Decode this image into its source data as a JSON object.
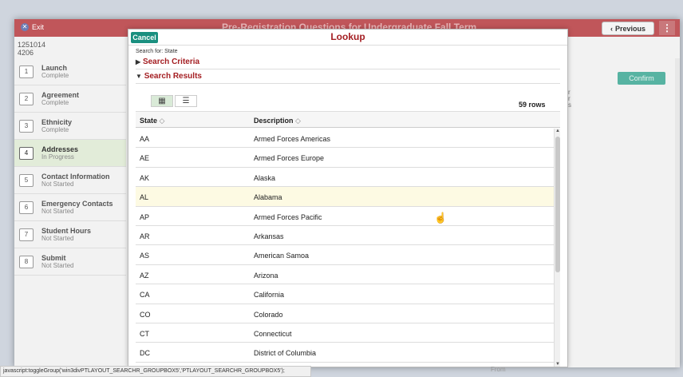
{
  "header": {
    "exit_label": "Exit",
    "exit_icon": "close-circle-icon",
    "title": "Pre-Registration Questions for Undergraduate Fall Term",
    "previous_label": "Previous",
    "menu_icon": "more-vertical-icon"
  },
  "ids": [
    "1251014",
    "4206"
  ],
  "nav": {
    "items": [
      {
        "number": "1",
        "title": "Launch",
        "status": "Complete"
      },
      {
        "number": "2",
        "title": "Agreement",
        "status": "Complete"
      },
      {
        "number": "3",
        "title": "Ethnicity",
        "status": "Complete"
      },
      {
        "number": "4",
        "title": "Addresses",
        "status": "In Progress"
      },
      {
        "number": "5",
        "title": "Contact Information",
        "status": "Not Started"
      },
      {
        "number": "6",
        "title": "Emergency Contacts",
        "status": "Not Started"
      },
      {
        "number": "7",
        "title": "Student Hours",
        "status": "Not Started"
      },
      {
        "number": "8",
        "title": "Submit",
        "status": "Not Started"
      }
    ]
  },
  "main": {
    "confirm_label": "Confirm",
    "fragments": [
      "r",
      "r",
      "s"
    ],
    "from_label": "From"
  },
  "modal": {
    "cancel_label": "Cancel",
    "title": "Lookup",
    "search_for": "Search for: State",
    "search_criteria_label": "Search Criteria",
    "search_results_label": "Search Results",
    "grid_view_icon": "grid-view-icon",
    "list_view_icon": "list-view-icon",
    "rows_count": "59 rows",
    "columns": {
      "state": "State",
      "description": "Description"
    },
    "rows": [
      {
        "state": "AA",
        "description": "Armed Forces Americas"
      },
      {
        "state": "AE",
        "description": "Armed Forces Europe"
      },
      {
        "state": "AK",
        "description": "Alaska"
      },
      {
        "state": "AL",
        "description": "Alabama"
      },
      {
        "state": "AP",
        "description": "Armed Forces Pacific"
      },
      {
        "state": "AR",
        "description": "Arkansas"
      },
      {
        "state": "AS",
        "description": "American Samoa"
      },
      {
        "state": "AZ",
        "description": "Arizona"
      },
      {
        "state": "CA",
        "description": "California"
      },
      {
        "state": "CO",
        "description": "Colorado"
      },
      {
        "state": "CT",
        "description": "Connecticut"
      },
      {
        "state": "DC",
        "description": "District of Columbia"
      }
    ],
    "hovered_row": "AL"
  },
  "statusbar": {
    "text": "javascript:toggleGroup('win3divPTLAYOUT_SEARCHR_GROUPBOX5','PTLAYOUT_SEARCHR_GROUPBOX5');"
  },
  "colors": {
    "header_bg": "#c0565a",
    "accent_red": "#a41e22",
    "cancel_teal": "#1a8f7f",
    "confirm_teal": "#57b3a2",
    "active_step_bg": "#e2ecd9",
    "hover_row_bg": "#fdfae3"
  }
}
